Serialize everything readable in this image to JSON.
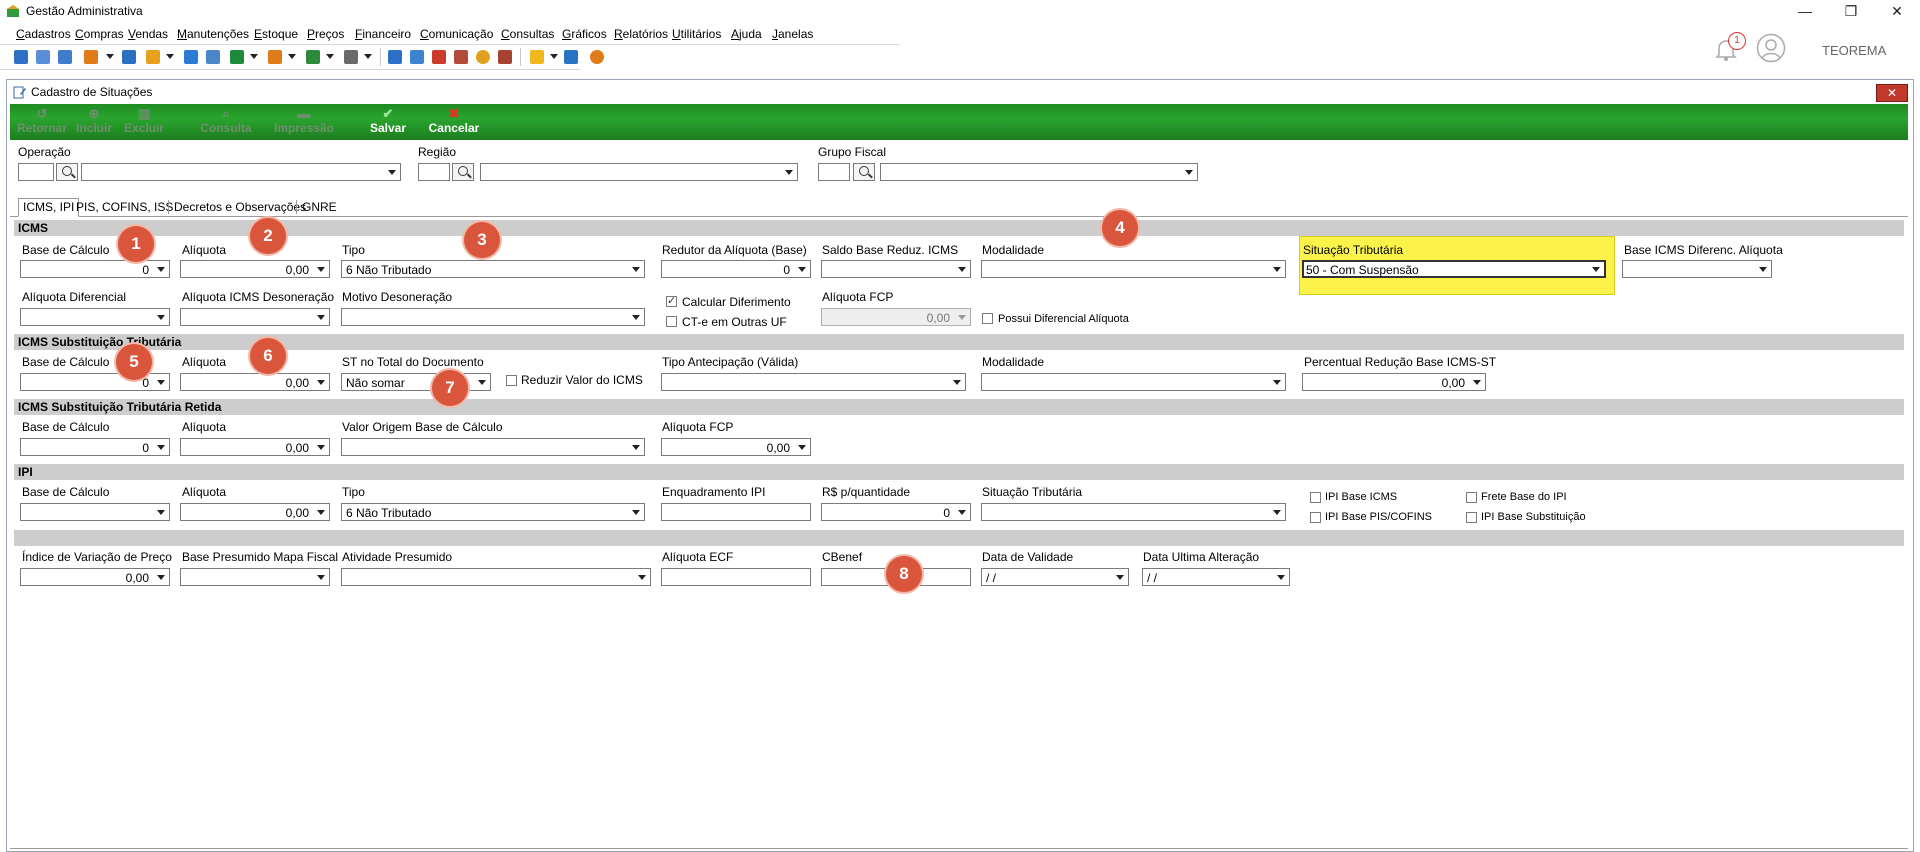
{
  "app": {
    "title": "Gestão Administrativa",
    "user": "TEOREMA",
    "notification_count": "1"
  },
  "menu": [
    "Cadastros",
    "Compras",
    "Vendas",
    "Manutenções",
    "Estoque",
    "Preços",
    "Financeiro",
    "Comunicação",
    "Consultas",
    "Gráficos",
    "Relatórios",
    "Utilitários",
    "Ajuda",
    "Janelas"
  ],
  "window": {
    "title": "Cadastro de Situações",
    "close": "✕"
  },
  "actions": {
    "retornar": "Retornar",
    "incluir": "Incluir",
    "excluir": "Excluir",
    "consulta": "Consulta",
    "impressao": "Impressão",
    "salvar": "Salvar",
    "cancelar": "Cancelar"
  },
  "header": {
    "operacao": "Operação",
    "regiao": "Região",
    "grupo_fiscal": "Grupo Fiscal"
  },
  "tabs": [
    "ICMS, IPI",
    "PIS, COFINS, ISS",
    "Decretos e Observações",
    "GNRE"
  ],
  "icms": {
    "section": "ICMS",
    "base_calculo": {
      "label": "Base de Cálculo",
      "value": "0"
    },
    "aliquota": {
      "label": "Alíquota",
      "value": "0,00"
    },
    "tipo": {
      "label": "Tipo",
      "value": "6 Não Tributado"
    },
    "redutor": {
      "label": "Redutor da Alíquota (Base)",
      "value": "0"
    },
    "saldo_base": {
      "label": "Saldo Base Reduz. ICMS"
    },
    "modalidade": {
      "label": "Modalidade"
    },
    "situacao": {
      "label": "Situação Tributária",
      "value": "50 - Com Suspensão"
    },
    "base_dif": {
      "label": "Base ICMS Diferenc. Alíquota"
    },
    "aliq_dif": {
      "label": "Alíquota Diferencial"
    },
    "aliq_deson": {
      "label": "Alíquota ICMS Desoneração"
    },
    "motivo_deson": {
      "label": "Motivo Desoneração"
    },
    "calc_diferimento": "Calcular Diferimento",
    "cte_outras_uf": "CT-e em Outras UF",
    "aliq_fcp": {
      "label": "Alíquota FCP",
      "value": "0,00"
    },
    "possui_dif": "Possui Diferencial Alíquota"
  },
  "icms_st": {
    "section": "ICMS Substituição Tributária",
    "base_calculo": {
      "label": "Base de Cálculo",
      "value": "0"
    },
    "aliquota": {
      "label": "Alíquota",
      "value": "0,00"
    },
    "st_total": {
      "label": "ST no Total do Documento",
      "value": "Não somar"
    },
    "reduzir": "Reduzir Valor do ICMS",
    "tipo_antecipacao": {
      "label": "Tipo Antecipação (Válida)"
    },
    "modalidade": {
      "label": "Modalidade"
    },
    "perc_reducao": {
      "label": "Percentual Redução Base ICMS-ST",
      "value": "0,00"
    }
  },
  "icms_st_retida": {
    "section": "ICMS Substituição Tributária Retida",
    "base_calculo": {
      "label": "Base de Cálculo",
      "value": "0"
    },
    "aliquota": {
      "label": "Alíquota",
      "value": "0,00"
    },
    "valor_origem": {
      "label": "Valor Origem Base de Cálculo"
    },
    "aliq_fcp": {
      "label": "Alíquota FCP",
      "value": "0,00"
    }
  },
  "ipi": {
    "section": "IPI",
    "base_calculo": {
      "label": "Base de Cálculo"
    },
    "aliquota": {
      "label": "Alíquota",
      "value": "0,00"
    },
    "tipo": {
      "label": "Tipo",
      "value": "6 Não Tributado"
    },
    "enquadramento": {
      "label": "Enquadramento IPI"
    },
    "rs_quantidade": {
      "label": "R$ p/quantidade",
      "value": "0"
    },
    "situacao": {
      "label": "Situação Tributária"
    },
    "base_icms": "IPI Base ICMS",
    "base_pis": "IPI Base PIS/COFINS",
    "frete_base": "Frete Base do IPI",
    "base_subst": "IPI Base Substituição"
  },
  "outros": {
    "indice": {
      "label": "Índice de Variação de Preço",
      "value": "0,00"
    },
    "base_presumido": {
      "label": "Base Presumido Mapa Fiscal"
    },
    "atividade": {
      "label": "Atividade Presumido"
    },
    "aliq_ecf": {
      "label": "Alíquota ECF"
    },
    "cbenef": {
      "label": "CBenef"
    },
    "data_validade": {
      "label": "Data de Validade",
      "value": "/ /"
    },
    "data_alteracao": {
      "label": "Data Ultima Alteração",
      "value": "/ /"
    }
  },
  "markers": [
    "1",
    "2",
    "3",
    "4",
    "5",
    "6",
    "7",
    "8"
  ],
  "colors": {
    "green": "#2aa52e",
    "highlight": "#fbf24a",
    "marker": "#d9553b",
    "section": "#cdcdcd"
  }
}
